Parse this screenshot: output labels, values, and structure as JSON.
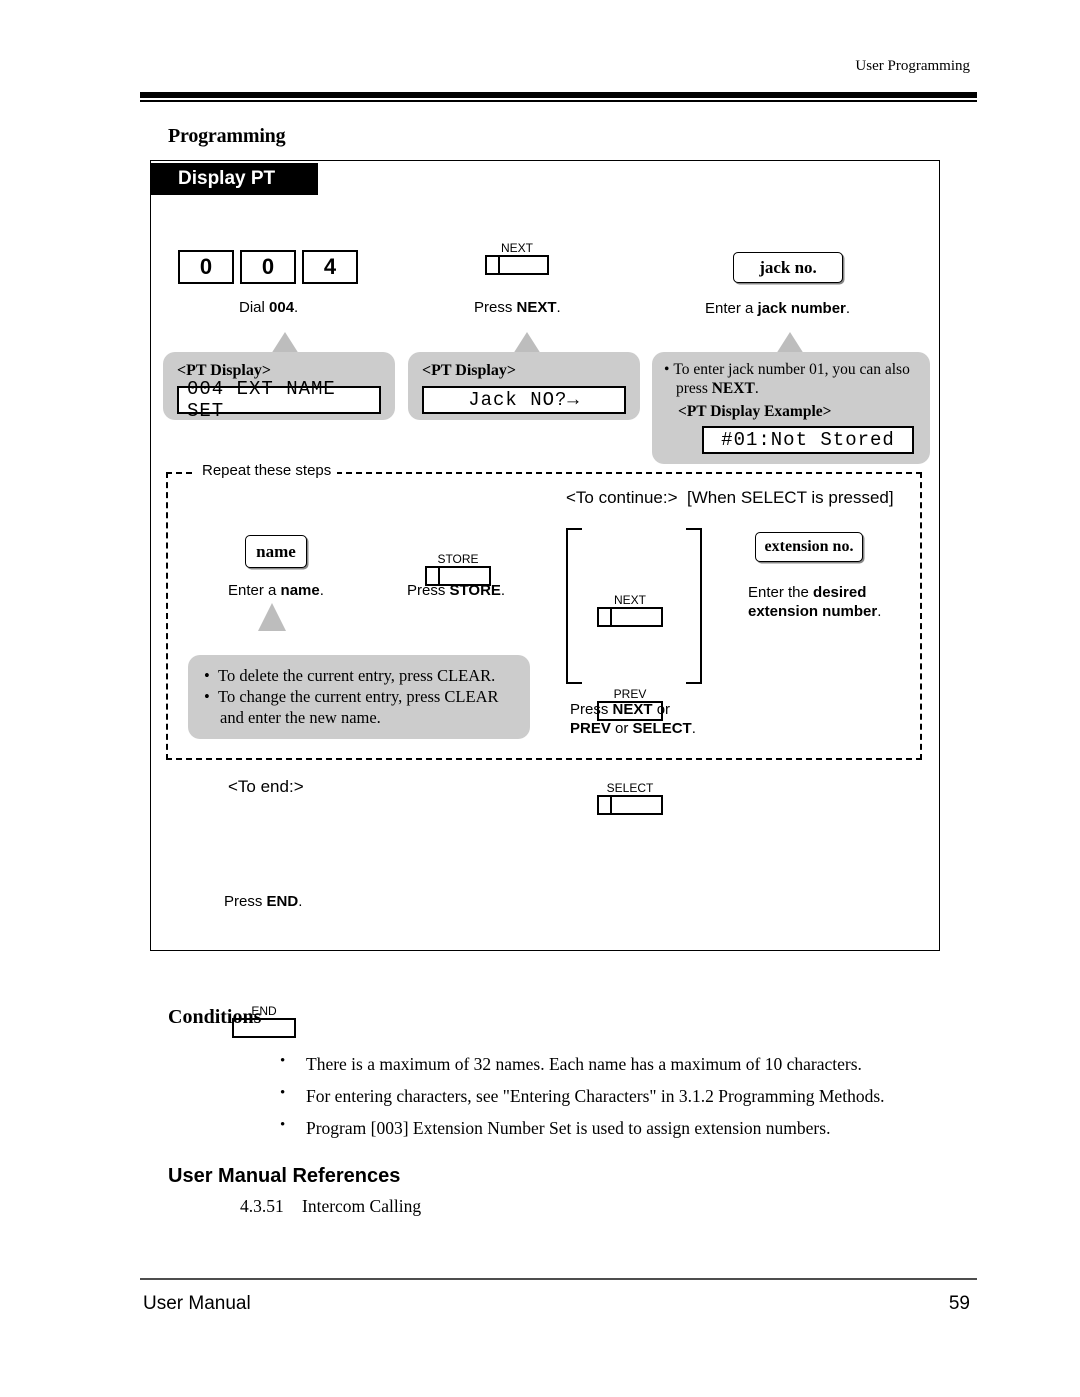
{
  "header": {
    "running_head": "User Programming"
  },
  "sections": {
    "programming_heading": "Programming",
    "conditions_heading": "Conditions",
    "references_heading": "User Manual References"
  },
  "diagram": {
    "tab_label": "Display PT",
    "dial": {
      "digits": [
        "0",
        "0",
        "4"
      ],
      "caption_prefix": "Dial ",
      "caption_bold": "004",
      "caption_suffix": "."
    },
    "next_key": {
      "cap": "NEXT",
      "caption_prefix": "Press ",
      "caption_bold": "NEXT",
      "caption_suffix": "."
    },
    "jack": {
      "box_label": "jack no.",
      "caption_prefix": "Enter a ",
      "caption_bold": "jack number",
      "caption_suffix": "."
    },
    "callout_pt_display_1": {
      "title": "<PT Display>",
      "lcd": "004 EXT NAME SET"
    },
    "callout_pt_display_2": {
      "title": "<PT Display>",
      "lcd": "Jack NO?→"
    },
    "callout_example": {
      "bullet_part1": "To enter jack number 01, you can also press ",
      "bullet_bold": "NEXT",
      "bullet_part2": ".",
      "title": "<PT Display Example>",
      "lcd": "#01:Not Stored"
    },
    "repeat_label": "Repeat these steps",
    "continue_label": "<To continue:>",
    "continue_condition": "[When SELECT is pressed]",
    "name": {
      "box_label": "name",
      "caption_prefix": "Enter a ",
      "caption_bold": "name",
      "caption_suffix": "."
    },
    "store_key": {
      "cap": "STORE",
      "caption_prefix": "Press ",
      "caption_bold": "STORE",
      "caption_suffix": "."
    },
    "nav_keys": {
      "next_cap": "NEXT",
      "prev_cap": "PREV",
      "select_cap": "SELECT",
      "caption_line1_prefix": "Press ",
      "caption_line1_bold": "NEXT",
      "caption_line1_suffix": " or",
      "caption_line2_bold1": "PREV",
      "caption_line2_mid": " or ",
      "caption_line2_bold2": "SELECT",
      "caption_line2_suffix": "."
    },
    "extension": {
      "box_label": "extension no.",
      "caption_line1_prefix": "Enter the ",
      "caption_line1_bold": "desired",
      "caption_line2_bold": "extension number",
      "caption_line2_suffix": "."
    },
    "callout_clear": {
      "bullet1": "To delete the current entry, press CLEAR.",
      "bullet2": "To change the current entry, press CLEAR and enter the new name."
    },
    "end": {
      "to_end_label": "<To end:>",
      "cap": "END",
      "caption_prefix": "Press ",
      "caption_bold": "END",
      "caption_suffix": "."
    }
  },
  "conditions": [
    "There is a maximum of 32 names. Each name has a maximum of 10 characters.",
    "For entering characters, see \"Entering Characters\" in 3.1.2    Programming Methods.",
    "Program [003] Extension Number Set is used to assign extension numbers."
  ],
  "references": [
    {
      "number": "4.3.51",
      "title": "Intercom Calling"
    }
  ],
  "footer": {
    "left": "User Manual",
    "page": "59"
  },
  "colors": {
    "callout_gray": "#cccccc",
    "pointer_gray": "#bdbdbd",
    "tab_black": "#000000"
  }
}
